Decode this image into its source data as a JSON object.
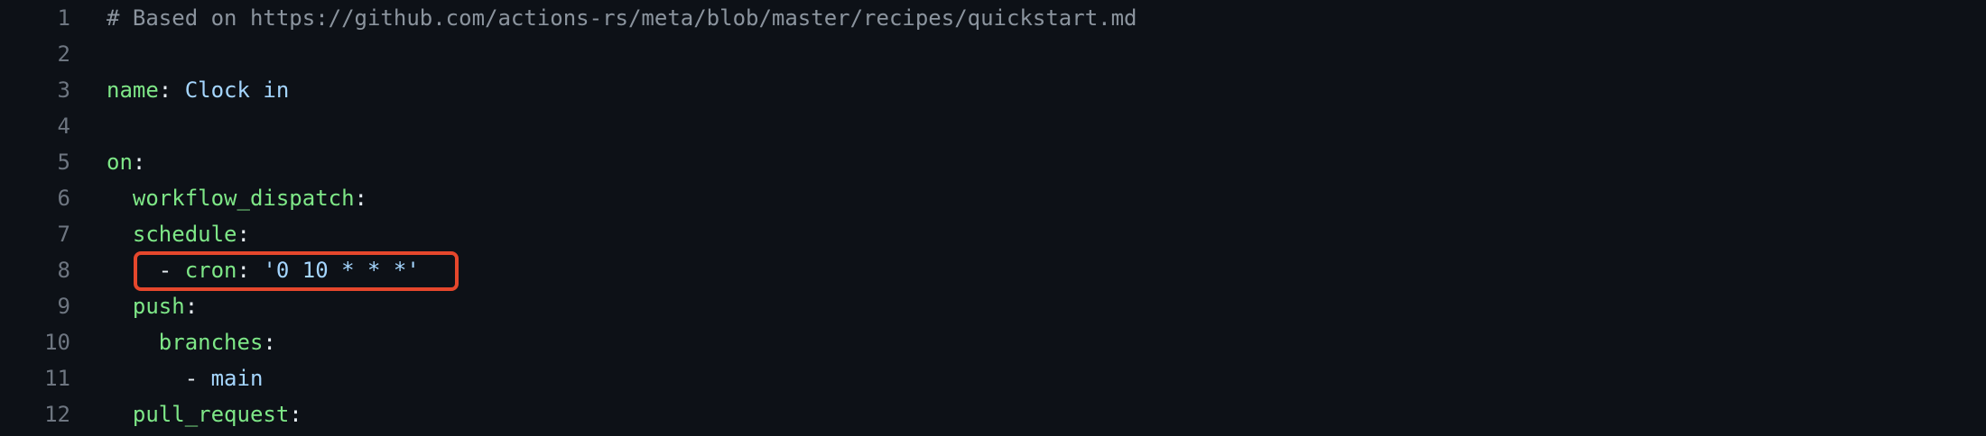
{
  "file": {
    "lines": [
      {
        "n": "1",
        "comment": "# Based on https://github.com/actions-rs/meta/blob/master/recipes/quickstart.md"
      },
      {
        "n": "2"
      },
      {
        "n": "3",
        "indent": "",
        "key": "name",
        "colon": ":",
        "value": " Clock in"
      },
      {
        "n": "4"
      },
      {
        "n": "5",
        "indent": "",
        "key": "on",
        "colon": ":"
      },
      {
        "n": "6",
        "indent": "  ",
        "key": "workflow_dispatch",
        "colon": ":"
      },
      {
        "n": "7",
        "indent": "  ",
        "key": "schedule",
        "colon": ":"
      },
      {
        "n": "8",
        "indent": "    ",
        "dash": "- ",
        "key": "cron",
        "colon": ":",
        "value": " '0 10 * * *'"
      },
      {
        "n": "9",
        "indent": "  ",
        "key": "push",
        "colon": ":"
      },
      {
        "n": "10",
        "indent": "    ",
        "key": "branches",
        "colon": ":"
      },
      {
        "n": "11",
        "indent": "      ",
        "dash": "- ",
        "value": "main"
      },
      {
        "n": "12",
        "indent": "  ",
        "key": "pull_request",
        "colon": ":"
      }
    ]
  },
  "colors": {
    "background": "#0d1117",
    "line_number": "#6e7681",
    "comment": "#8b949e",
    "key": "#7ee787",
    "string": "#a5d6ff",
    "highlight_box": "#e5472c"
  }
}
